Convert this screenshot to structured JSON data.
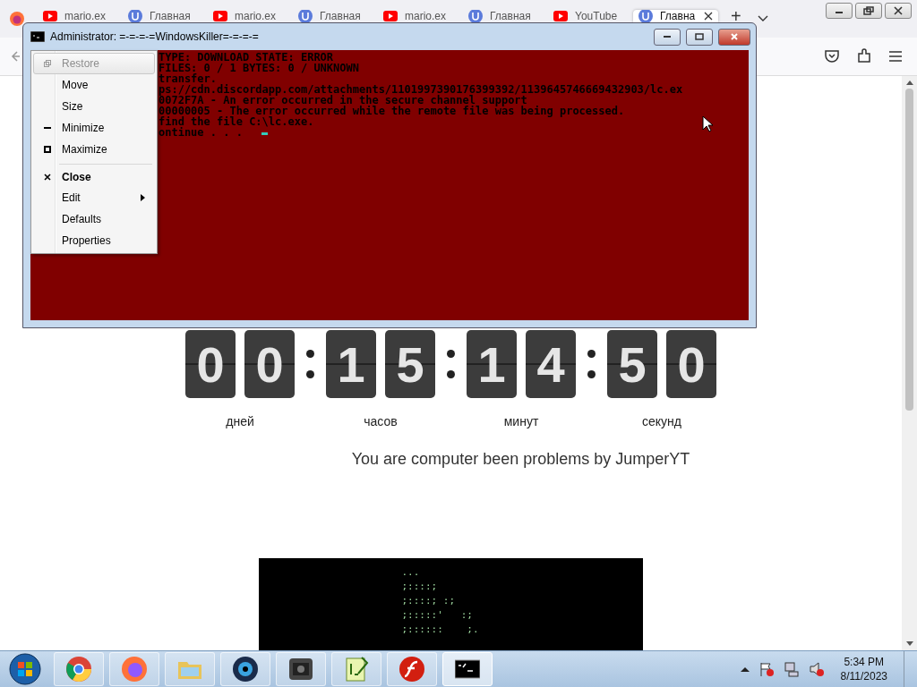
{
  "browser": {
    "tabs": [
      {
        "label": "mario.ex",
        "kind": "youtube",
        "selected": false
      },
      {
        "label": "Главная",
        "kind": "letter",
        "selected": false
      },
      {
        "label": "mario.ex",
        "kind": "youtube",
        "selected": false
      },
      {
        "label": "Главная",
        "kind": "letter",
        "selected": false
      },
      {
        "label": "mario.ex",
        "kind": "youtube",
        "selected": false
      },
      {
        "label": "Главная",
        "kind": "letter",
        "selected": false
      },
      {
        "label": "YouTube",
        "kind": "youtube",
        "selected": false
      },
      {
        "label": "Главна",
        "kind": "letter",
        "selected": true
      }
    ],
    "new_tab": "+"
  },
  "page": {
    "countdown": [
      {
        "digits": [
          "0",
          "0"
        ],
        "label": "дней"
      },
      {
        "digits": [
          "1",
          "5"
        ],
        "label": "часов"
      },
      {
        "digits": [
          "1",
          "4"
        ],
        "label": "минут"
      },
      {
        "digits": [
          "5",
          "0"
        ],
        "label": "секунд"
      }
    ],
    "message": "You are computer been problems by JumperYT",
    "ascii_art": [
      "...",
      ";::::;",
      ";::::; :;",
      ";:::::'   :;",
      ";::::::    ;."
    ]
  },
  "console": {
    "title": "Administrator:  =-=-=-=WindowsKiller=-=-=-=",
    "lines": [
      "TYPE: DOWNLOAD STATE: ERROR",
      "FILES: 0 / 1 BYTES: 0 / UNKNOWN",
      "transfer.",
      "ps://cdn.discordapp.com/attachments/1101997390176399392/1139645746669432903/lc.ex",
      "0072F7A - An error occurred in the secure channel support",
      "00000005 - The error occurred while the remote file was being processed.",
      "find the file C:\\lc.exe.",
      "ontinue . . . "
    ]
  },
  "system_menu": [
    {
      "label": "Restore",
      "kind": "restore",
      "disabled": true,
      "bold": false,
      "submenu": false,
      "separator_before": false
    },
    {
      "label": "Move",
      "kind": "plain",
      "disabled": false,
      "bold": false,
      "submenu": false,
      "separator_before": false
    },
    {
      "label": "Size",
      "kind": "plain",
      "disabled": false,
      "bold": false,
      "submenu": false,
      "separator_before": false
    },
    {
      "label": "Minimize",
      "kind": "minimize",
      "disabled": false,
      "bold": false,
      "submenu": false,
      "separator_before": false
    },
    {
      "label": "Maximize",
      "kind": "maximize",
      "disabled": false,
      "bold": false,
      "submenu": false,
      "separator_before": false
    },
    {
      "label": "Close",
      "kind": "close",
      "disabled": false,
      "bold": true,
      "submenu": false,
      "separator_before": true
    },
    {
      "label": "Edit",
      "kind": "plain",
      "disabled": false,
      "bold": false,
      "submenu": true,
      "separator_before": false
    },
    {
      "label": "Defaults",
      "kind": "plain",
      "disabled": false,
      "bold": false,
      "submenu": false,
      "separator_before": false
    },
    {
      "label": "Properties",
      "kind": "plain",
      "disabled": false,
      "bold": false,
      "submenu": false,
      "separator_before": false
    }
  ],
  "taskbar": {
    "apps": [
      {
        "kind": "chrome",
        "selected": false
      },
      {
        "kind": "firefox",
        "selected": false
      },
      {
        "kind": "folder",
        "selected": false
      },
      {
        "kind": "camera",
        "selected": false
      },
      {
        "kind": "video",
        "selected": false
      },
      {
        "kind": "notepad",
        "selected": false
      },
      {
        "kind": "flash",
        "selected": false
      },
      {
        "kind": "console",
        "selected": true
      }
    ],
    "time": "5:34 PM",
    "date": "8/11/2023"
  }
}
